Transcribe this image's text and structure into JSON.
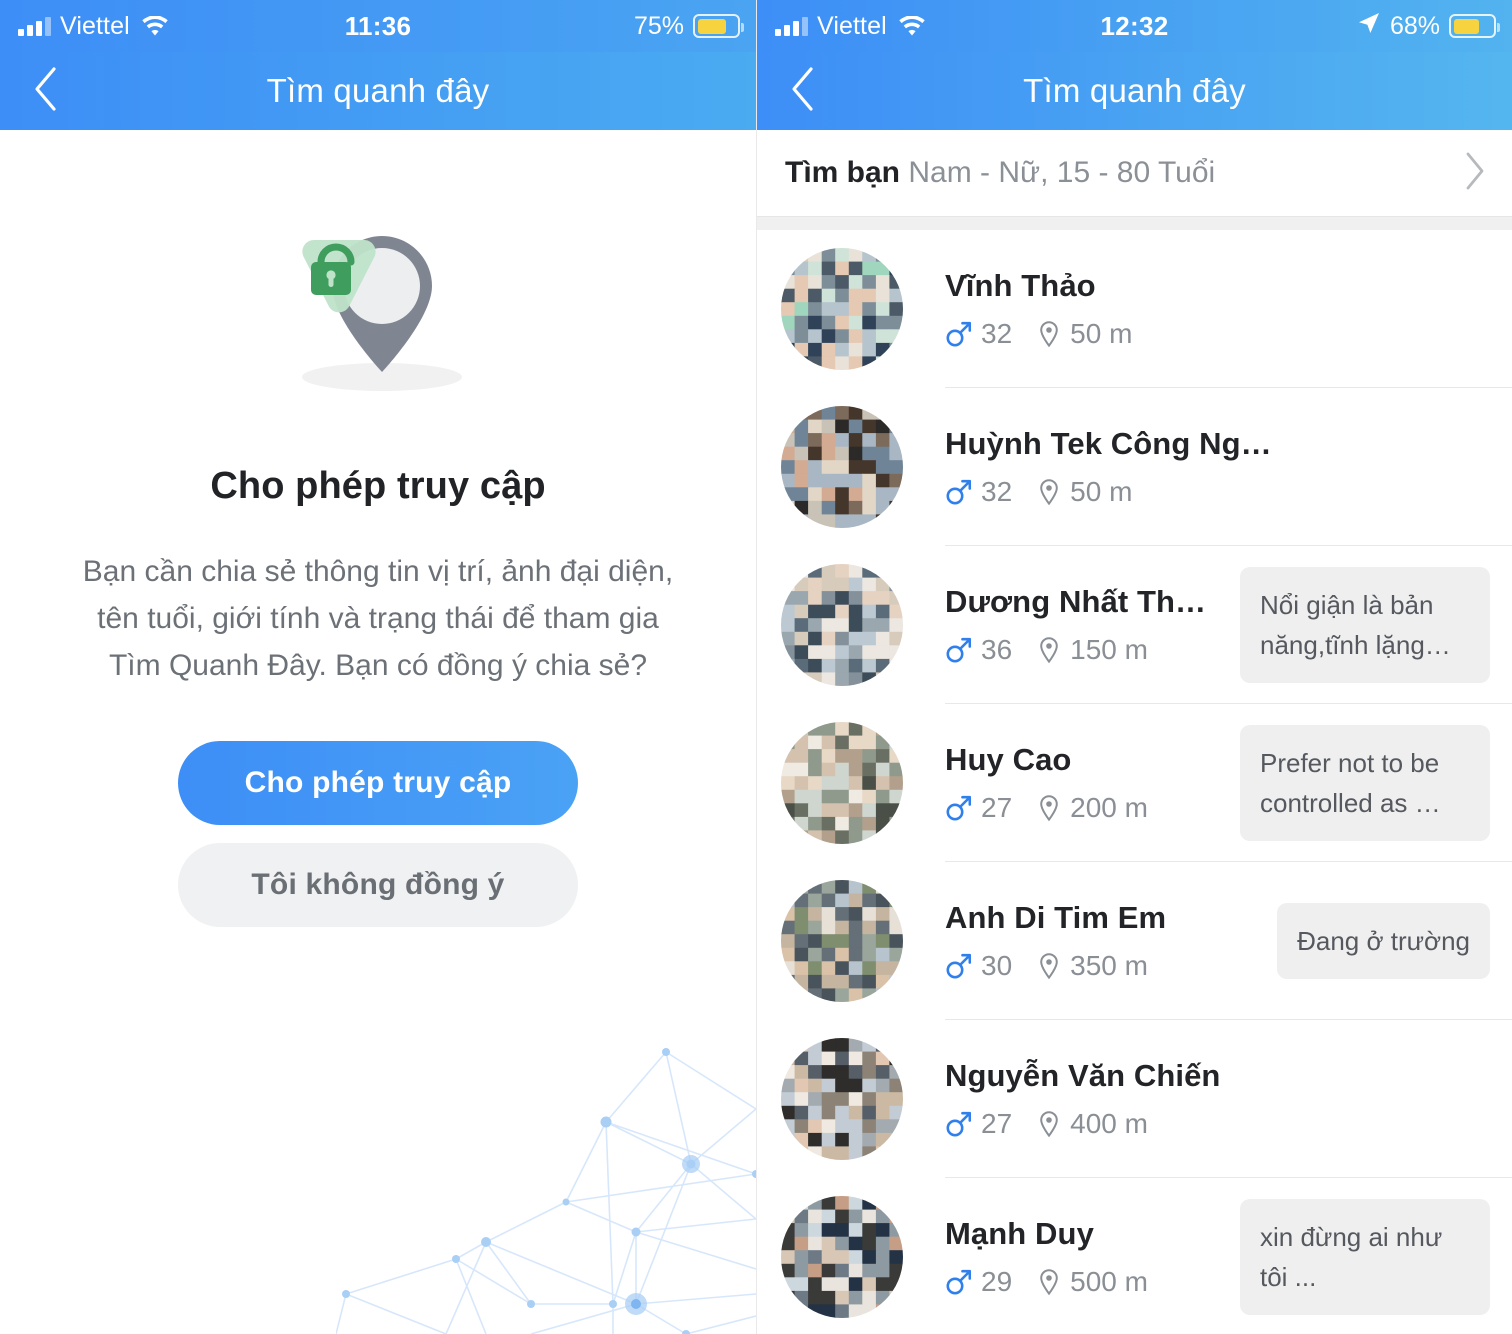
{
  "left": {
    "status_bar": {
      "carrier": "Viettel",
      "time": "11:36",
      "battery": "75%",
      "signal_icon": "cellular-signal-icon",
      "wifi_icon": "wifi-icon",
      "battery_icon": "battery-icon"
    },
    "nav": {
      "back_icon": "back-chevron-icon",
      "title": "Tìm quanh đây"
    },
    "permission": {
      "icon": "location-pin-unlocked-icon",
      "title": "Cho phép truy cập",
      "description": "Bạn cần chia sẻ thông tin vị trí, ảnh đại diện, tên tuổi, giới tính và trạng thái để tham gia Tìm Quanh Đây. Bạn có đồng ý chia sẻ?",
      "allow_label": "Cho phép truy cập",
      "deny_label": "Tôi không đồng ý",
      "decoration": "network-nodes-graphic"
    }
  },
  "right": {
    "status_bar": {
      "carrier": "Viettel",
      "time": "12:32",
      "battery": "68%",
      "signal_icon": "cellular-signal-icon",
      "wifi_icon": "wifi-icon",
      "location_icon": "location-arrow-icon",
      "battery_icon": "battery-icon"
    },
    "nav": {
      "back_icon": "back-chevron-icon",
      "title": "Tìm quanh đây"
    },
    "filter": {
      "label": "Tìm bạn",
      "value": "Nam - Nữ, 15 - 80 Tuổi",
      "chevron_icon": "chevron-right-icon"
    },
    "people": [
      {
        "name": "Vĩnh Thảo",
        "gender_icon": "male-icon",
        "age": "32",
        "pin_icon": "map-pin-icon",
        "distance": "50 m",
        "note": ""
      },
      {
        "name": "Huỳnh Tek Công Nghệ",
        "gender_icon": "male-icon",
        "age": "32",
        "pin_icon": "map-pin-icon",
        "distance": "50 m",
        "note": ""
      },
      {
        "name": "Dương Nhất Thư…",
        "gender_icon": "male-icon",
        "age": "36",
        "pin_icon": "map-pin-icon",
        "distance": "150 m",
        "note": "Nổi giận là bản năng,tĩnh lặng…"
      },
      {
        "name": "Huy Cao",
        "gender_icon": "male-icon",
        "age": "27",
        "pin_icon": "map-pin-icon",
        "distance": "200 m",
        "note": "Prefer not to be controlled as …"
      },
      {
        "name": "Anh Di Tim Em",
        "gender_icon": "male-icon",
        "age": "30",
        "pin_icon": "map-pin-icon",
        "distance": "350 m",
        "note": "Đang ở trường"
      },
      {
        "name": "Nguyễn Văn Chiến",
        "gender_icon": "male-icon",
        "age": "27",
        "pin_icon": "map-pin-icon",
        "distance": "400 m",
        "note": ""
      },
      {
        "name": "Mạnh Duy",
        "gender_icon": "male-icon",
        "age": "29",
        "pin_icon": "map-pin-icon",
        "distance": "500 m",
        "note": "xin đừng ai như tôi ..."
      }
    ]
  },
  "colors": {
    "header_blue_start": "#3d8ef6",
    "header_blue_end": "#52b3ef",
    "primary_button": "#3d8ef6",
    "battery_yellow": "#f7d33f",
    "male_blue": "#2f80ed",
    "note_bg": "#efefef",
    "text_dark": "#232428",
    "text_muted": "#8a8f95",
    "lock_green": "#3f9e5e",
    "pin_gray": "#808691"
  }
}
